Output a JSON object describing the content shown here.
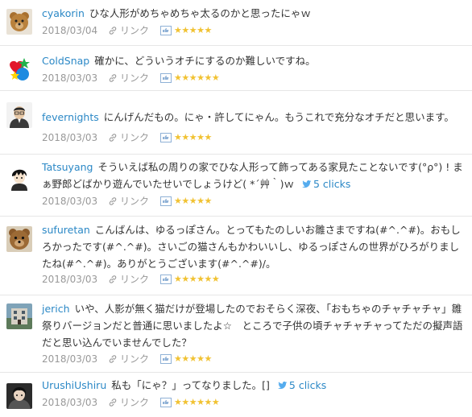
{
  "comments": [
    {
      "user": "cyakorin",
      "text": "ひな人形がめちゃめちゃ太るのかと思ったにゃｗ",
      "date": "2018/03/04",
      "link_label": "リンク",
      "stars": "★★★★★",
      "avatar_icon": "teddy-bear-avatar-icon"
    },
    {
      "user": "ColdSnap",
      "text": "確かに、どういうオチにするのか難しいですね。",
      "date": "2018/03/03",
      "link_label": "リンク",
      "stars": "★★★★★★",
      "avatar_icon": "heart-star-avatar-icon"
    },
    {
      "user": "fevernights",
      "text": "にんげんだもの。にゃ・許してにゃん。もうこれで充分なオチだと思います。",
      "date": "2018/03/03",
      "link_label": "リンク",
      "stars": "★★★★★",
      "avatar_icon": "portrait-avatar-icon"
    },
    {
      "user": "Tatsuyang",
      "text": "そういえば私の周りの家でひな人形って飾ってある家見たことないです(°ρ°) ! まぁ野郎どばかり遊んでいたせいでしょうけど( *´艸｀)ｗ",
      "clicks": "5 clicks",
      "date": "2018/03/03",
      "link_label": "リンク",
      "stars": "★★★★★",
      "avatar_icon": "anime-boy-avatar-icon"
    },
    {
      "user": "sufuretan",
      "text": "こんばんは、ゆるっぽさん。とってもたのしいお雛さまですね(#^.^#)。おもしろかったです(#^.^#)。さいごの猫さんもかわいいし、ゆるっぽさんの世界がひろがりましたね(#^.^#)。ありがとうございます(#^.^#)/。",
      "date": "2018/03/03",
      "link_label": "リンク",
      "stars": "★★★★★★",
      "avatar_icon": "teddy-bear-avatar-icon"
    },
    {
      "user": "jerich",
      "text": "いや、人影が無く猫だけが登場したのでおそらく深夜、「おもちゃのチャチャチャ」雛祭りバージョンだと普通に思いましたよ☆　ところで子供の頃チャチャチャってただの擬声語だと思い込んでいませんでした？",
      "date": "2018/03/03",
      "link_label": "リンク",
      "stars": "★★★★★",
      "avatar_icon": "building-avatar-icon"
    },
    {
      "user": "UrushiUshiru",
      "text": "私も「にゃ？」ってなりました。[]",
      "clicks": "5 clicks",
      "date": "2018/03/03",
      "link_label": "リンク",
      "stars": "★★★★★★",
      "avatar_icon": "dark-character-avatar-icon"
    }
  ]
}
